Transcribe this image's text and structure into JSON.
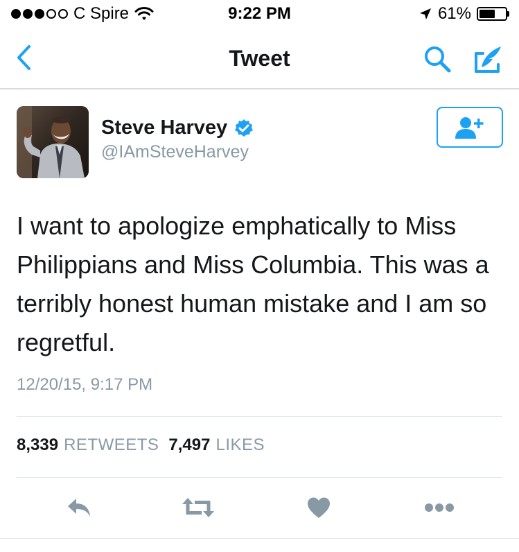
{
  "status_bar": {
    "signal_filled": 3,
    "signal_total": 5,
    "carrier": "C Spire",
    "time": "9:22 PM",
    "battery": "61%",
    "battery_level": 0.61
  },
  "nav": {
    "title": "Tweet",
    "back_icon": "chevron-left-icon",
    "search_icon": "search-icon",
    "compose_icon": "compose-icon"
  },
  "tweet": {
    "author_name": "Steve Harvey",
    "author_handle": "@IAmSteveHarvey",
    "verified": true,
    "text": "I want to apologize emphatically to Miss Philippians and Miss Columbia. This was a terribly honest human mistake and I am so regretful.",
    "timestamp": "12/20/15, 9:17 PM",
    "retweet_count": "8,339",
    "retweet_label": "RETWEETS",
    "like_count": "7,497",
    "like_label": "LIKES"
  },
  "colors": {
    "accent": "#1da1f2",
    "text": "#14171a",
    "secondary": "#8899a6",
    "action_icon": "#8899a6",
    "divider": "#e1e8ed"
  }
}
